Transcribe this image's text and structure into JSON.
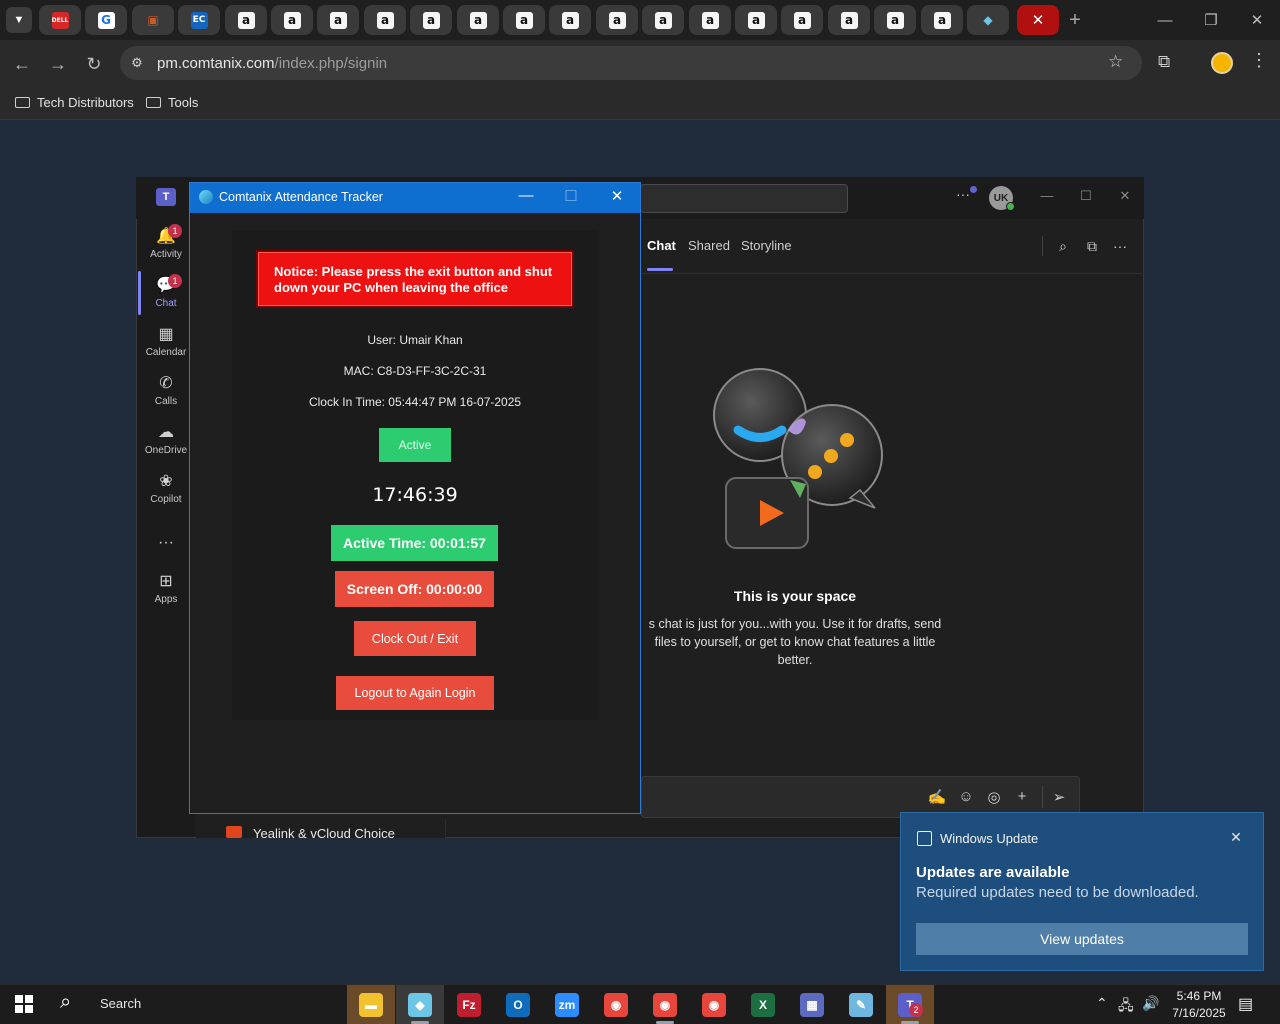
{
  "browser": {
    "tabs": [
      {
        "icon": "dell-icon",
        "glyph": "DELL",
        "color": "#d62828",
        "active": false
      },
      {
        "icon": "g-brand-icon",
        "glyph": "G",
        "color": "#1a73e8",
        "active": false
      },
      {
        "icon": "package-icon",
        "glyph": "▣",
        "color": "#c85a2a",
        "active": false
      },
      {
        "icon": "ec-icon",
        "glyph": "EC",
        "color": "#1565c0",
        "active": false
      },
      {
        "icon": "amazon-icon",
        "glyph": "a",
        "color": "#111111",
        "active": false
      },
      {
        "icon": "amazon-icon",
        "glyph": "a",
        "color": "#111111",
        "active": false
      },
      {
        "icon": "amazon-icon",
        "glyph": "a",
        "color": "#f5f5f5",
        "active": false
      },
      {
        "icon": "amazon-icon",
        "glyph": "a",
        "color": "#f5f5f5",
        "active": false
      },
      {
        "icon": "amazon-icon",
        "glyph": "a",
        "color": "#f5f5f5",
        "active": false
      },
      {
        "icon": "amazon-icon",
        "glyph": "a",
        "color": "#f5f5f5",
        "active": false
      },
      {
        "icon": "amazon-icon",
        "glyph": "a",
        "color": "#f5f5f5",
        "active": false
      },
      {
        "icon": "amazon-icon",
        "glyph": "a",
        "color": "#f5f5f5",
        "active": false
      },
      {
        "icon": "amazon-icon",
        "glyph": "a",
        "color": "#f5f5f5",
        "active": false
      },
      {
        "icon": "amazon-icon",
        "glyph": "a",
        "color": "#f5f5f5",
        "active": false
      },
      {
        "icon": "amazon-icon",
        "glyph": "a",
        "color": "#f5f5f5",
        "active": false
      },
      {
        "icon": "amazon-icon",
        "glyph": "a",
        "color": "#f5f5f5",
        "active": false
      },
      {
        "icon": "amazon-icon",
        "glyph": "a",
        "color": "#f5f5f5",
        "active": false
      },
      {
        "icon": "amazon-icon",
        "glyph": "a",
        "color": "#f5f5f5",
        "active": false
      },
      {
        "icon": "amazon-icon",
        "glyph": "a",
        "color": "#f5f5f5",
        "active": false
      },
      {
        "icon": "amazon-icon",
        "glyph": "a",
        "color": "#f5f5f5",
        "active": false
      },
      {
        "icon": "comtanix-icon",
        "glyph": "◆",
        "color": "#6ec6e6",
        "active": false
      },
      {
        "icon": "close-icon",
        "glyph": "✕",
        "color": "#ffffff",
        "active": true
      }
    ],
    "url_host": "pm.comtanix.com",
    "url_path": "/index.php/signin",
    "bookmarks": [
      "Tech Distributors",
      "Tools"
    ]
  },
  "teams": {
    "avatar_initials": "UK",
    "rail": [
      {
        "label": "Activity",
        "icon": "bell-icon",
        "glyph": "🔔",
        "badge": "1"
      },
      {
        "label": "Chat",
        "icon": "chat-icon",
        "glyph": "💬",
        "badge": "1"
      },
      {
        "label": "Calendar",
        "icon": "calendar-icon",
        "glyph": "▦",
        "badge": ""
      },
      {
        "label": "Calls",
        "icon": "phone-icon",
        "glyph": "✆",
        "badge": ""
      },
      {
        "label": "OneDrive",
        "icon": "cloud-icon",
        "glyph": "☁",
        "badge": ""
      },
      {
        "label": "Copilot",
        "icon": "copilot-icon",
        "glyph": "❀",
        "badge": ""
      },
      {
        "label": "...",
        "icon": "more-icon",
        "glyph": "···",
        "badge": ""
      },
      {
        "label": "Apps",
        "icon": "apps-icon",
        "glyph": "⊞",
        "badge": ""
      }
    ],
    "chat_tabs": [
      "Chat",
      "Shared",
      "Storyline"
    ],
    "space_title": "This is your space",
    "space_text": "s chat is just for you...with you. Use it for drafts, send files to yourself, or get to know chat features a little better.",
    "list_item": "Yealink & vCloud Choice"
  },
  "tracker": {
    "title": "Comtanix Attendance Tracker",
    "notice": "Notice: Please press the exit button and shut down your PC when leaving the office",
    "user": "User: Umair Khan",
    "mac": "MAC: C8-D3-FF-3C-2C-31",
    "clock_in": "Clock In Time: 05:44:47 PM 16-07-2025",
    "status": "Active",
    "clock": "17:46:39",
    "active_time": "Active Time: 00:01:57",
    "screen_off": "Screen Off: 00:00:00",
    "clock_out": "Clock Out / Exit",
    "logout": "Logout to Again Login"
  },
  "toast": {
    "app": "Windows Update",
    "title": "Updates are available",
    "body": "Required updates need to be downloaded.",
    "button": "View updates"
  },
  "taskbar": {
    "search": "Search",
    "apps": [
      {
        "icon": "file-explorer-icon",
        "glyph": "▬",
        "color": "#f2c12e"
      },
      {
        "icon": "comtanix-tracker-icon",
        "glyph": "◆",
        "color": "#6ec6e6"
      },
      {
        "icon": "filezilla-icon",
        "glyph": "Fz",
        "color": "#bf1e2e"
      },
      {
        "icon": "outlook-icon",
        "glyph": "O",
        "color": "#0f6cbd"
      },
      {
        "icon": "zoom-icon",
        "glyph": "zm",
        "color": "#2d8cff"
      },
      {
        "icon": "chrome-icon",
        "glyph": "◉",
        "color": "#e8453c"
      },
      {
        "icon": "chrome-profile-icon",
        "glyph": "◉",
        "color": "#e8453c"
      },
      {
        "icon": "chrome-profile-icon",
        "glyph": "◉",
        "color": "#e8453c"
      },
      {
        "icon": "excel-icon",
        "glyph": "X",
        "color": "#1d6f42"
      },
      {
        "icon": "calculator-icon",
        "glyph": "▦",
        "color": "#5c6bc0"
      },
      {
        "icon": "notepad-icon",
        "glyph": "✎",
        "color": "#6fb6e0"
      },
      {
        "icon": "teams-icon",
        "glyph": "T",
        "color": "#5b5fc7"
      }
    ],
    "teams_badge": "2",
    "time": "5:46 PM",
    "date": "7/16/2025"
  }
}
